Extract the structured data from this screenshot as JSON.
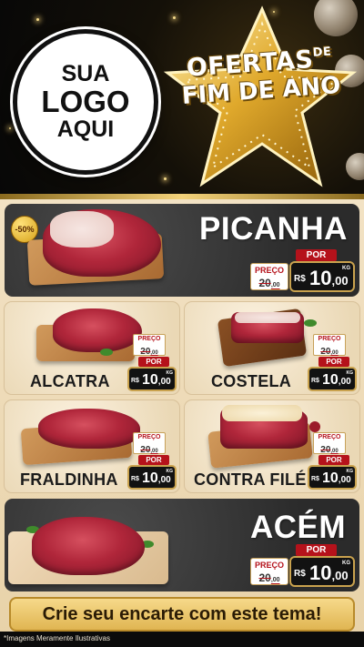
{
  "logo": {
    "line1": "SUA",
    "line2": "LOGO",
    "line3": "AQUI"
  },
  "banner": {
    "line1": "OFERTAS",
    "line1_suffix": "DE",
    "line2": "FIM DE ANO"
  },
  "labels": {
    "preco": "PREÇO",
    "por": "POR",
    "currency": "R$",
    "unit": "KG"
  },
  "products": [
    {
      "name": "PICANHA",
      "badge": "-50%",
      "old_price": "20",
      "old_cents": ",00",
      "price": "10",
      "cents": ",00"
    },
    {
      "name": "ALCATRA",
      "old_price": "20",
      "old_cents": ",00",
      "price": "10",
      "cents": ",00"
    },
    {
      "name": "COSTELA",
      "old_price": "20",
      "old_cents": ",00",
      "price": "10",
      "cents": ",00"
    },
    {
      "name": "FRALDINHA",
      "old_price": "20",
      "old_cents": ",00",
      "price": "10",
      "cents": ",00"
    },
    {
      "name": "CONTRA FILÉ",
      "old_price": "20",
      "old_cents": ",00",
      "price": "10",
      "cents": ",00"
    },
    {
      "name": "ACÉM",
      "old_price": "20",
      "old_cents": ",00",
      "price": "10",
      "cents": ",00"
    }
  ],
  "cta": "Crie seu encarte com este tema!",
  "disclaimer": "*Imagens Meramente Ilustrativas",
  "colors": {
    "accent_red": "#b5121b",
    "gold": "#c9a24e",
    "dark_panel": "#2b2b2b",
    "wood": "#f2e2c4"
  }
}
